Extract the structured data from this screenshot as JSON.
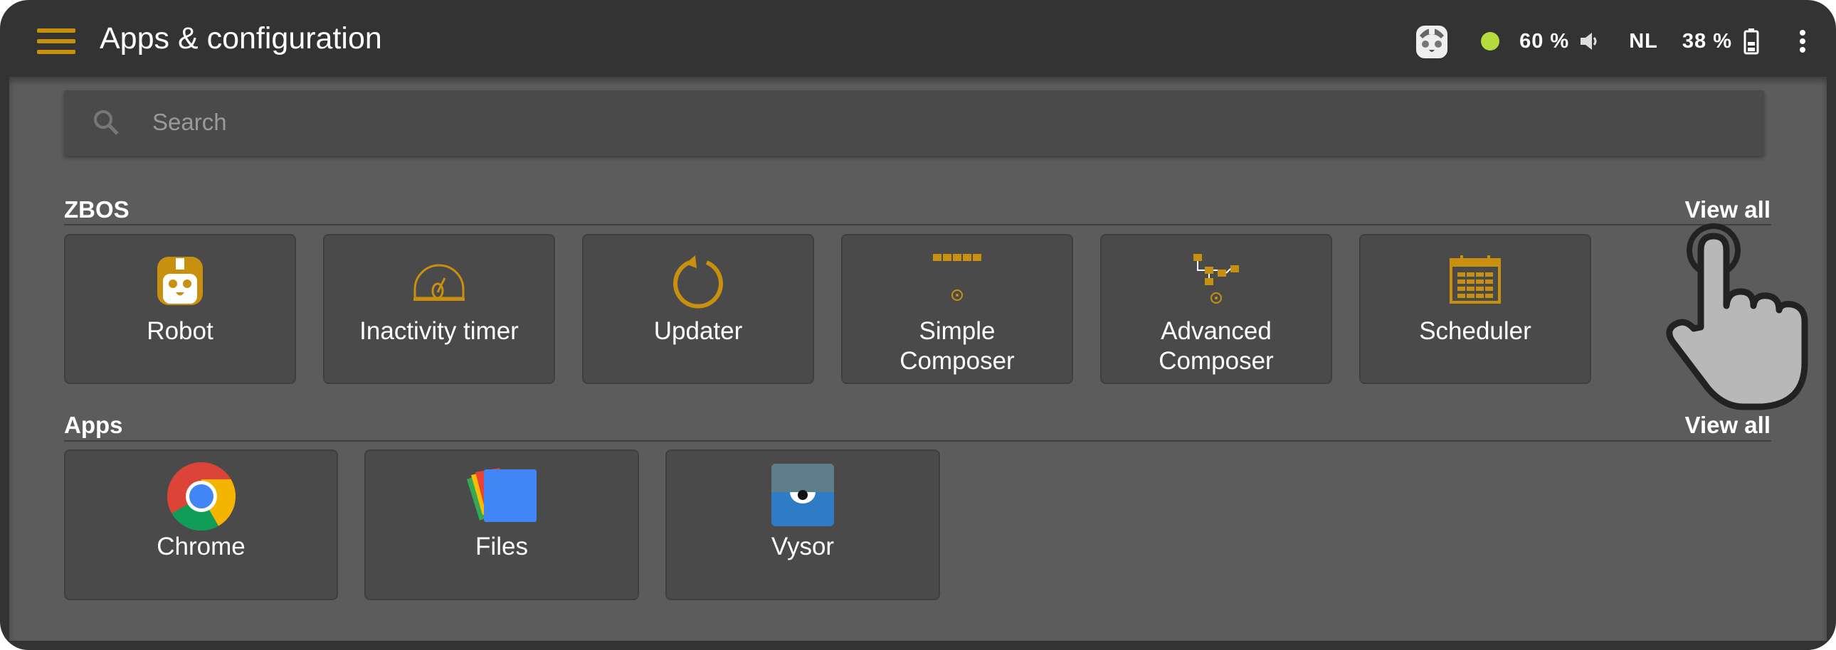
{
  "header": {
    "title": "Apps & configuration",
    "status": {
      "connection_color": "#b5dc3c",
      "volume": "60 %",
      "language": "NL",
      "battery": "38 %"
    }
  },
  "search": {
    "placeholder": "Search"
  },
  "sections": [
    {
      "label": "ZBOS",
      "view_all": "View all",
      "tiles": [
        {
          "label": "Robot",
          "icon": "robot-icon"
        },
        {
          "label": "Inactivity timer",
          "icon": "speedometer-icon"
        },
        {
          "label": "Updater",
          "icon": "refresh-icon"
        },
        {
          "label": "Simple Composer",
          "icon": "simple-composer-icon"
        },
        {
          "label": "Advanced Composer",
          "icon": "advanced-composer-icon"
        },
        {
          "label": "Scheduler",
          "icon": "calendar-icon"
        }
      ]
    },
    {
      "label": "Apps",
      "view_all": "View all",
      "tiles": [
        {
          "label": "Chrome",
          "icon": "chrome-icon"
        },
        {
          "label": "Files",
          "icon": "files-icon"
        },
        {
          "label": "Vysor",
          "icon": "vysor-icon"
        }
      ]
    }
  ],
  "accent": "#c8900e"
}
